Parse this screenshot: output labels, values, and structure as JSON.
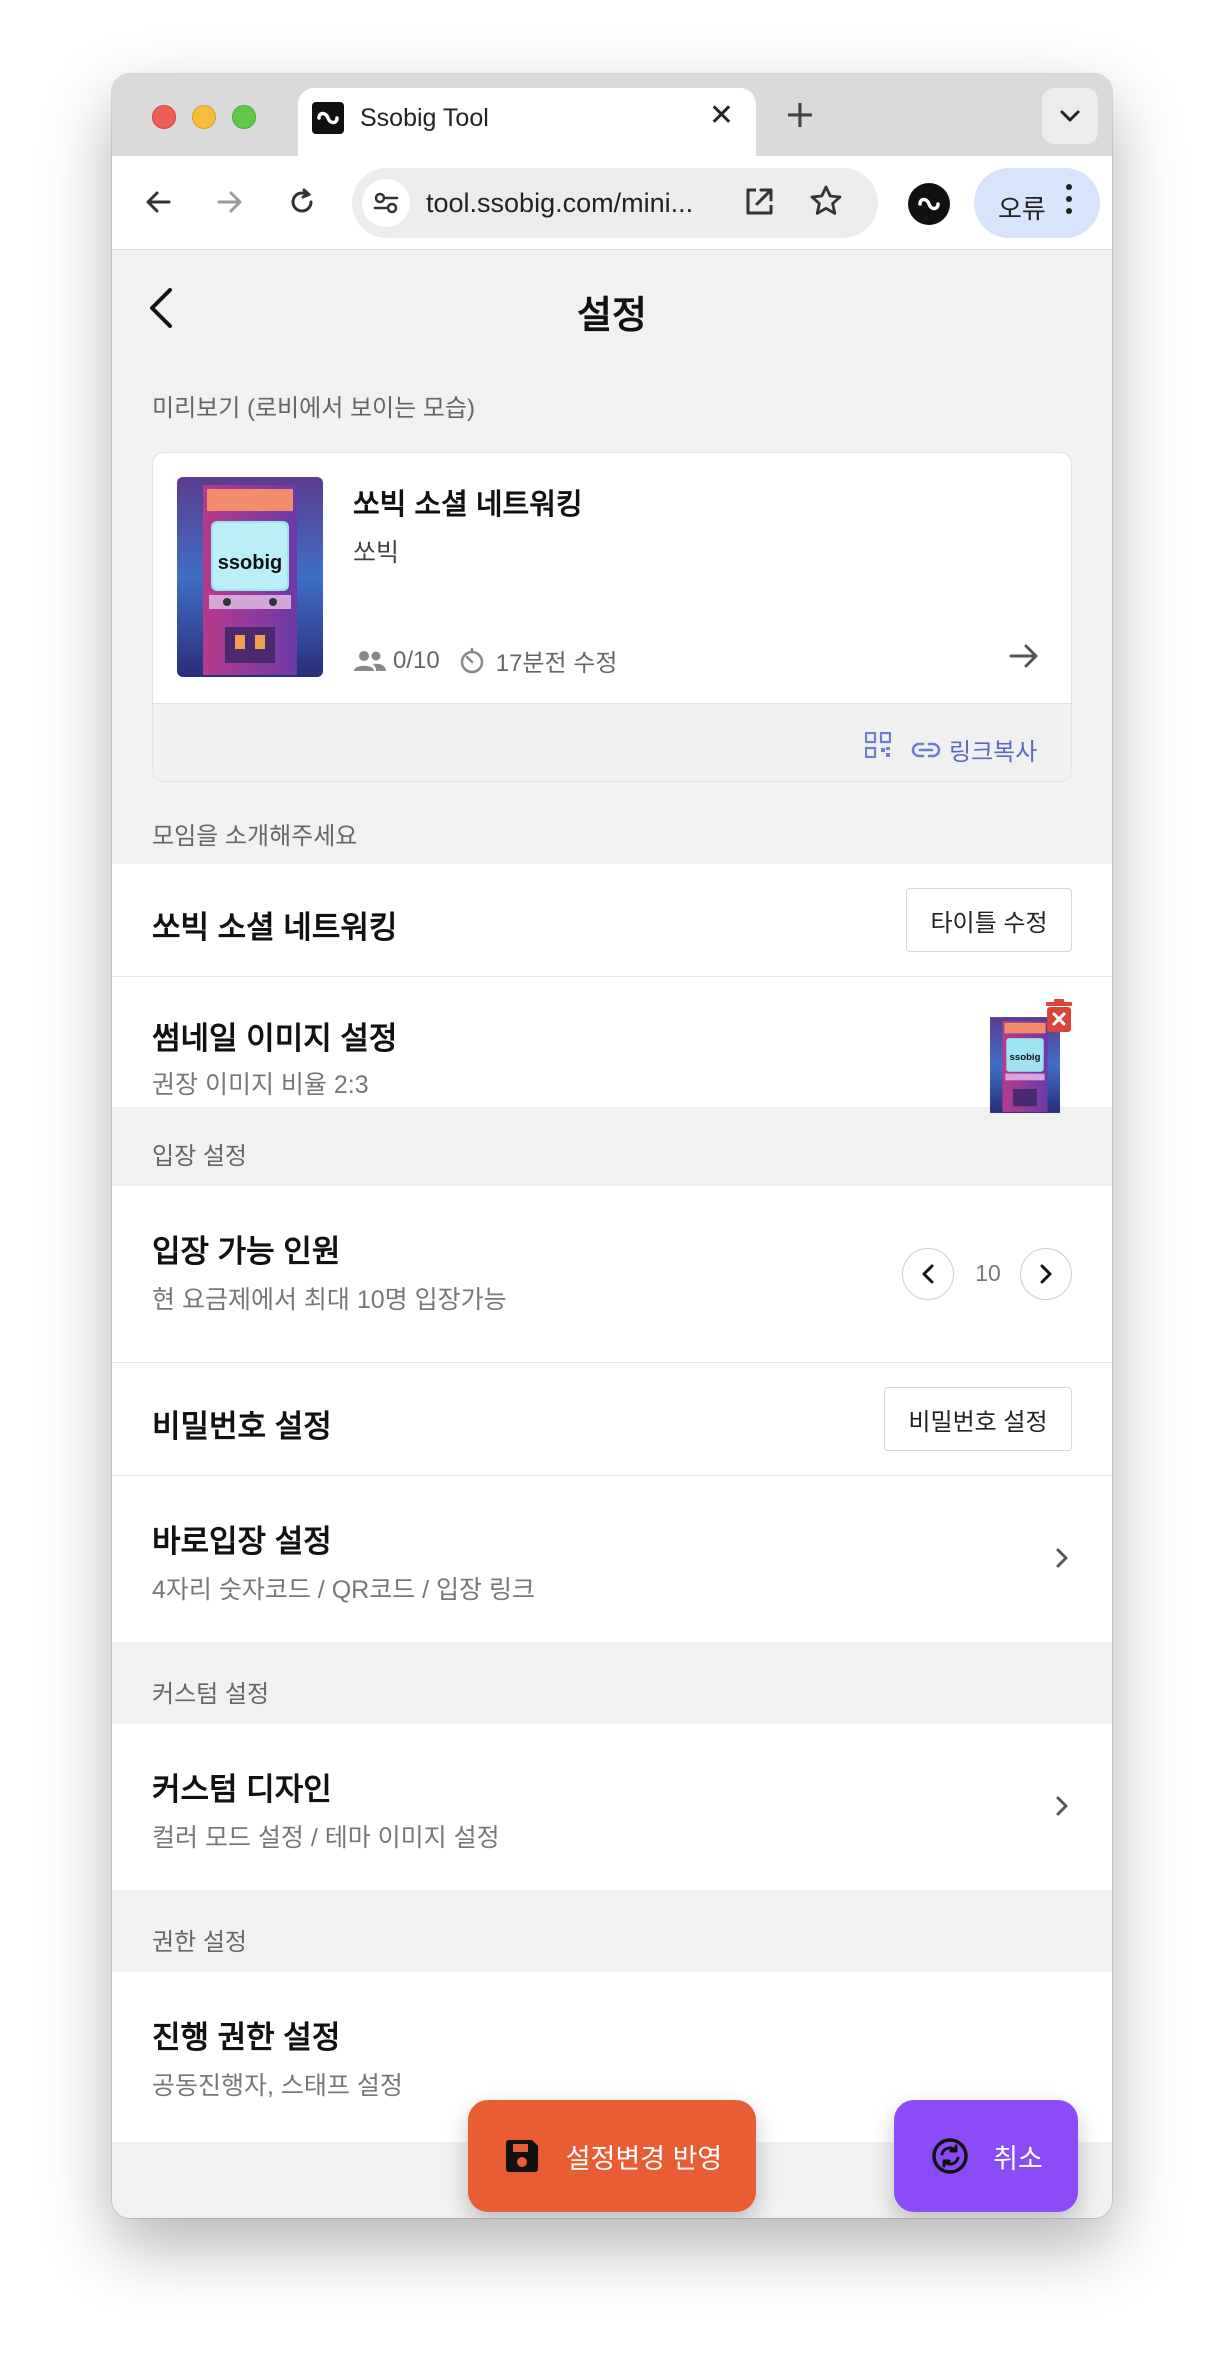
{
  "browser": {
    "tab_title": "Ssobig Tool",
    "new_tab": "+",
    "url": "tool.ssobig.com/mini...",
    "error_label": "오류"
  },
  "header": {
    "title": "설정"
  },
  "preview": {
    "section_label": "미리보기 (로비에서 보이는 모습)",
    "title": "쏘빅 소셜 네트워킹",
    "host": "쏘빅",
    "participants": "0/10",
    "edited": "17분전 수정",
    "thumb_text": "ssobig",
    "copy_link_label": "링크복사"
  },
  "intro": {
    "section_label": "모임을 소개해주세요",
    "title_value": "쏘빅 소셜 네트워킹",
    "edit_title_button": "타이틀 수정",
    "thumbnail_title": "썸네일 이미지 설정",
    "thumbnail_sub": "권장 이미지 비율 2:3"
  },
  "entry": {
    "section_label": "입장 설정",
    "capacity_title": "입장 가능 인원",
    "capacity_sub": "현 요금제에서 최대 10명 입장가능",
    "capacity_value": "10",
    "password_title": "비밀번호 설정",
    "password_button": "비밀번호 설정",
    "quick_title": "바로입장 설정",
    "quick_sub": "4자리 숫자코드 / QR코드 / 입장 링크"
  },
  "custom": {
    "section_label": "커스텀 설정",
    "design_title": "커스텀 디자인",
    "design_sub": "컬러 모드 설정 / 테마 이미지 설정"
  },
  "permission": {
    "section_label": "권한 설정",
    "title": "진행 권한 설정",
    "sub": "공동진행자, 스태프 설정"
  },
  "actions": {
    "save_label": "설정변경 반영",
    "cancel_label": "취소",
    "save_color": "#e85d33",
    "cancel_color": "#8b4cf7"
  }
}
